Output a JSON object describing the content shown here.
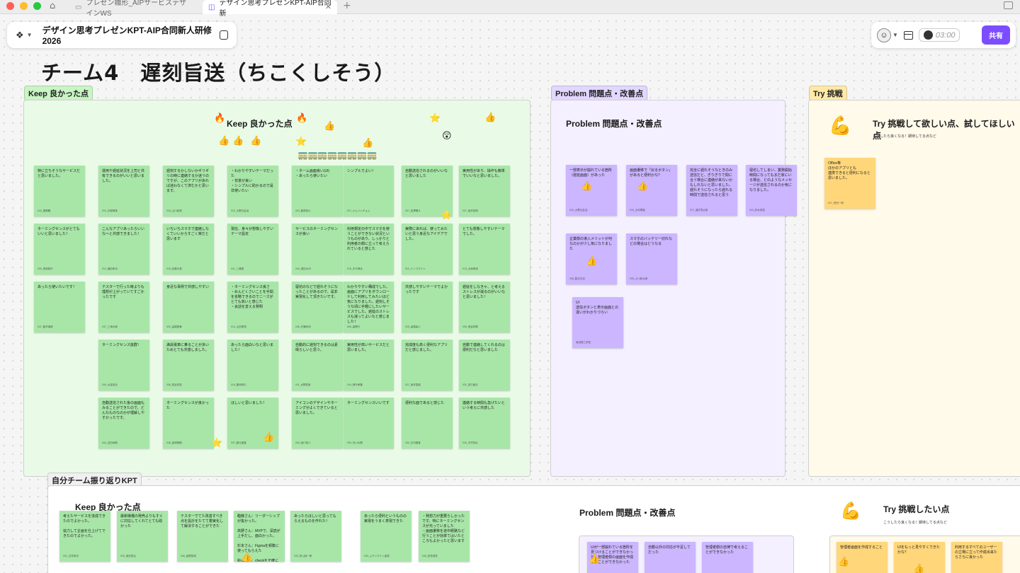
{
  "browser": {
    "tabs": [
      {
        "label": "プレゼン雛形_AIPサービスデザインWS"
      },
      {
        "label": "デザイン思考プレゼンKPT-AIP合同新"
      }
    ],
    "close_glyph": "✕",
    "new_tab_glyph": "+"
  },
  "toolbar": {
    "file_title": "デザイン思考プレゼンKPT-AIP合同新人研修2026",
    "timer": "03:00",
    "share_label": "共有"
  },
  "board": {
    "title": "チーム4　遅刻旨送（ちこくしそう）",
    "sections": {
      "keep_tag": "Keep 良かった点",
      "problem_tag": "Problem 問題点・改善点",
      "try_tag": "Try 挑戦",
      "retro_tag": "自分チーム振り返りKPT"
    },
    "keep": {
      "heading": "Keep 良かった点",
      "notes": [
        {
          "text": "特に立ちそうなサービスだと思いました。",
          "author": "043_乗務職"
        },
        {
          "text": "運用や遅延状況を上司と共有できるのがいいと思いました。",
          "author": "010_手稲明雄"
        },
        {
          "text": "遅刻するかしないかギリギリの時に連絡するか迷うのですが、このアプリがあれば迷わなくて済むかと思います。",
          "author": "043_山口紀昭"
        },
        {
          "text": "・わかりやすいテーマだった\n・背景が良い\n・シンプルに助かるので是非使いたい",
          "author": "012_大野社会活"
        },
        {
          "text": "・ネーム画面良い(UI)\n・あったら使いたい",
          "author": "023_藤原悠斗"
        },
        {
          "text": "シンプルでよい！",
          "author": "017_キムジンギョム"
        },
        {
          "text": "自動送信されるのがいいなと思いました",
          "author": "007_岩澤陽斗"
        },
        {
          "text": "実用性があり、操作も簡単でいいなと思いました。",
          "author": "027_坂本拓翔"
        },
        {
          "text": "ネーミングセンスがとてもいいと思いました！",
          "author": "030_長岡梨紗"
        },
        {
          "text": "こんなアプリあったらいいな〜と共感できました！",
          "author": "014_福田孝也"
        },
        {
          "text": "いちいちスマホで連絡しなくていいからすごく楽だと思います",
          "author": "018_佐藤天音"
        },
        {
          "text": "現在、身々が想像しやすいテーマ設定",
          "author": "021_三峰愛"
        },
        {
          "text": "サービスのネーミングセンスが良い",
          "author": "034_須田大河"
        },
        {
          "text": "利用規定の中でスマホを使うことができない状況というものがあり、しっかりと利用者の側に立って考えられていると感じた",
          "author": "019_中平博也"
        },
        {
          "text": "実際にあれば、使ってみたいと思う身近なアイデアでした。",
          "author": "012_ナンマグナン"
        },
        {
          "text": "とても想像しやすいテーマでした。",
          "author": "013_大嶋孝悠"
        },
        {
          "text": "あったら使いたいです！",
          "author": "047_藤沢達郎"
        },
        {
          "text": "テスターで行った時よりも理想が上がっていてすごかったです",
          "author": "037_三浦大樹"
        },
        {
          "text": "身近な事例で共感しやすい",
          "author": "020_高橋愛華"
        },
        {
          "text": "・ネーミングセンス良さ\n・めんどくさいことを手間を省略できるのでニーズがとても高いと感じた\n・会話を変える発明",
          "author": "013_山田秀悟"
        },
        {
          "text": "寝坊のなどで遅れそうになったことがあるので、是非実現化して頂きたいです。",
          "author": "045_村瀬未知"
        },
        {
          "text": "わかりやすい構成でした。\n画面にアプリをダウンロードして利用してみたいほど気になりました。遅刻しそうな頃に手軽にしたいサービスでした。遅延のストレスも減ってよいなと感じました！",
          "author": "005_高野行"
        },
        {
          "text": "共感しやすいテーマでよかったです",
          "author": "025_高橋紹人"
        },
        {
          "text": "遅延をしなきゃ、と考えるストレスが減るのがいいなと思いました！",
          "author": "039_長谷林健"
        },
        {
          "text": "ネーミングセンス抜群！",
          "author": "034_大高真也"
        },
        {
          "text": "満員電車に乗ることが多いためとても共感しました。",
          "author": "036_長谷真吾"
        },
        {
          "text": "あったら面白いなと思いました！",
          "author": "015_藤岡卓巳"
        },
        {
          "text": "自動的に遅刻できるのは素晴らしいと思う。",
          "author": "011_水野智薫"
        },
        {
          "text": "実用性が高いサービスだと思いました。",
          "author": "019_神代孝隆"
        },
        {
          "text": "完成度も高く便利なアプリだと感じました。",
          "author": "027_坂本智樹"
        },
        {
          "text": "自動で連絡してくれるのは便利だなと思いました",
          "author": "032_田中亜矢"
        },
        {
          "text": "自動送信された後の画面もみることができたので、どんなものなのかが理解しやすかったです。",
          "author": "044_吉田幸樹"
        },
        {
          "text": "ネーミングセンスが良かった",
          "author": "048_高明徳樹"
        },
        {
          "text": "ほしいと思いました！",
          "author": "047_藤元遥香"
        },
        {
          "text": "アイコンのデザインやネーミングがよくできていると思いました。",
          "author": "004_坂口真人"
        },
        {
          "text": "ネーミングセンスいいです",
          "author": "009_市川大輝"
        },
        {
          "text": "便利な面であると感じた",
          "author": "040_石河春香"
        },
        {
          "text": "連絡する時間も急げたいという考えに共感した",
          "author": "034_中村茂太"
        }
      ]
    },
    "problem": {
      "heading": "Problem 問題点・改善点",
      "notes": [
        {
          "text": "一部表示が崩れている箇所（遅延画面）があった",
          "author": "010_大野社会活"
        },
        {
          "text": "画面遷移で「戻るボタン」があると便利かな？",
          "author": "010_大坪陽香"
        },
        {
          "text": "完全に遅れそうなときのみ送信だと、ぎりぎりで間に合う場合に連絡が来ないかもしれないと思いました。遅れそうになったら遅れる時間で送信されると思う",
          "author": "017_酒井寿太郎"
        },
        {
          "text": "寝坊してしまい、業務開始時間になってもまだ家にいる場合、どのようなメッセージが送信されるのか気になりました。",
          "author": "024_鈴木真悟"
        },
        {
          "text": "企業側の導入メリットが何なのかが少し気になりました",
          "author": "035_藤井志羽"
        },
        {
          "text": "スマホのバッテリー切れなどの場合はどうなる",
          "author": "005_小川和太郎"
        },
        {
          "text": "UI\n送信ボタンと表示画面との違いがわかりづらい",
          "author": "坂田優三伊佐"
        }
      ]
    },
    "try": {
      "heading": "Try 挑戦して欲しい点、試してほしい点",
      "sub": "こうしたら良くなる！期待してる点など",
      "notes": [
        {
          "text": "Office等\nほかのアプリとも\n連携できると便利になると思いました。",
          "author": "017_安田一明"
        }
      ]
    },
    "retro": {
      "keep_heading": "Keep 良かった点",
      "problem_heading": "Problem 問題点・改善点",
      "try_heading": "Try 挑戦したい点",
      "try_sub": "こうしたら良くなる！期待してる点など",
      "keep_notes": [
        {
          "text": "考えたサービスを達成できたのでよかった。\n\n協力して企画を仕上げてできたのでよかった。",
          "author": "031_日本鉄也"
        },
        {
          "text": "最新機種の発売よりもすぐに対応してくれてとても助かった",
          "author": "033_奥田真治"
        },
        {
          "text": "テスターでてた改善すべき点を設計をたてて着実化して解決することができた",
          "author": "046_高野智瑛"
        },
        {
          "text": "臨機さん：リーダーシップが抜かった。\n\n高野さん：MVPで、深読が上手だし、面白かった。\n\n杉本さん：Figmaを頻繁に使ってもらえた\n\n鈴山さん：checkを正確にしてくれ",
          "author": ""
        },
        {
          "text": "あったらほしいと思ってもらえるものを作れた！",
          "author": "033_鈴山純一郎"
        },
        {
          "text": "あったら便利というものの実現をうまく表現できた",
          "author": "033_ムチングナン高見"
        },
        {
          "text": "・発想力が重要らしかったです。特にネーミングセンスが光っていました\n・画面遷移を途中経路など行うことが効率てはいたところもよかったと思います",
          "author": "046_柏島慎吾"
        }
      ],
      "problem_notes": [
        {
          "text": "UIが一部崩れている箇所を見つけることができなかった。管理者側の画面を作成することができなかった",
          "author": ""
        },
        {
          "text": "自動以外の対応が不足してだった",
          "author": ""
        },
        {
          "text": "管理者側の自律で考えることができなかった",
          "author": ""
        }
      ],
      "try_notes": [
        {
          "text": "管理者画面を作成すること",
          "author": ""
        },
        {
          "text": "UIをもっと見やすくできたかな？",
          "author": ""
        },
        {
          "text": "利用するすべてのユーザーの立場に立って作成出来たらさらに良かった",
          "author": ""
        }
      ]
    }
  }
}
